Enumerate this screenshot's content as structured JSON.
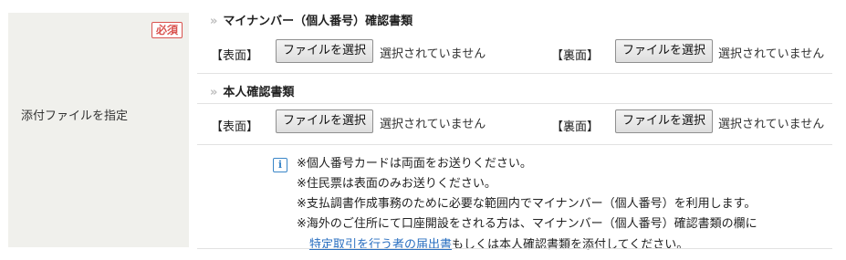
{
  "left": {
    "badge": "必須",
    "label": "添付ファイルを指定"
  },
  "sections": [
    {
      "title": "マイナンバー（個人番号）確認書類",
      "front_label": "【表面】",
      "back_label": "【裏面】",
      "button_label": "ファイルを選択",
      "status": "選択されていません"
    },
    {
      "title": "本人確認書類",
      "front_label": "【表面】",
      "back_label": "【裏面】",
      "button_label": "ファイルを選択",
      "status": "選択されていません"
    }
  ],
  "notes": {
    "icon": "info-icon",
    "lines": [
      "※個人番号カードは両面をお送りください。",
      "※住民票は表面のみお送りください。",
      "※支払調書作成事務のために必要な範囲内でマイナンバー（個人番号）を利用します。",
      "※海外のご住所にて口座開設をされる方は、マイナンバー（個人番号）確認書類の欄に"
    ],
    "link_text": "特定取引を行う者の届出書",
    "last_suffix": "もしくは本人確認書類を添付してください。"
  },
  "colors": {
    "badge": "#d9534f",
    "left_bg": "#f0f0ec",
    "link": "#2a6fc0",
    "info": "#3a86c8"
  }
}
